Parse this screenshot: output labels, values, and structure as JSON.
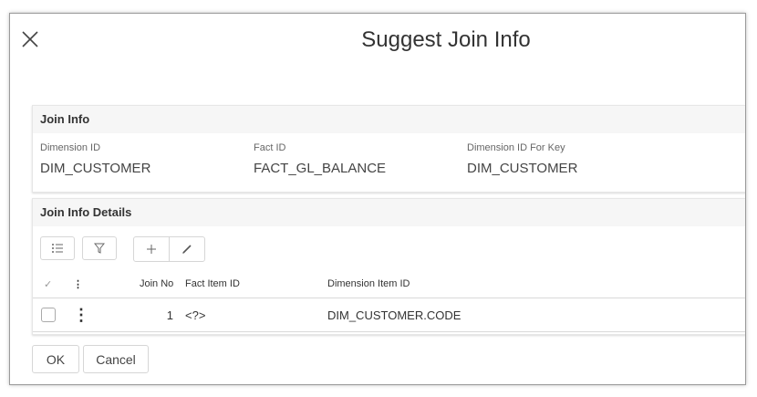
{
  "dialog": {
    "title": "Suggest Join Info",
    "close_icon": "close-icon"
  },
  "join_info": {
    "heading": "Join Info",
    "fields": [
      {
        "label": "Dimension ID",
        "value": "DIM_CUSTOMER"
      },
      {
        "label": "Fact ID",
        "value": "FACT_GL_BALANCE"
      },
      {
        "label": "Dimension ID For Key",
        "value": "DIM_CUSTOMER"
      }
    ]
  },
  "join_details": {
    "heading": "Join Info Details",
    "toolbar": {
      "icons": [
        "list-settings-icon",
        "filter-icon",
        "plus-icon",
        "pencil-icon"
      ]
    },
    "columns": {
      "check": "✓",
      "menu": "⋮",
      "join_no": "Join No",
      "fact_item_id": "Fact Item ID",
      "dimension_item_id": "Dimension Item ID"
    },
    "rows": [
      {
        "menu": "⋮",
        "join_no": "1",
        "fact_item_id": "<?>",
        "dimension_item_id": "DIM_CUSTOMER.CODE"
      }
    ]
  },
  "footer": {
    "ok_label": "OK",
    "cancel_label": "Cancel"
  }
}
